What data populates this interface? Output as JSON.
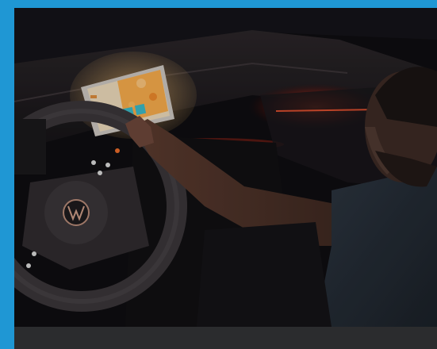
{
  "photo": {
    "subject": "person-touching-car-infotainment-screen",
    "colors": {
      "frame": "#1f97d4",
      "caption_bar": "#2b2c2e",
      "ambient_light": "#ff3a1a",
      "screen_glow": "#f3a94a",
      "screen_tile_teal": "#3bb7c4"
    },
    "icons": [
      "steering-wheel",
      "vw-logo",
      "infotainment-screen"
    ]
  }
}
